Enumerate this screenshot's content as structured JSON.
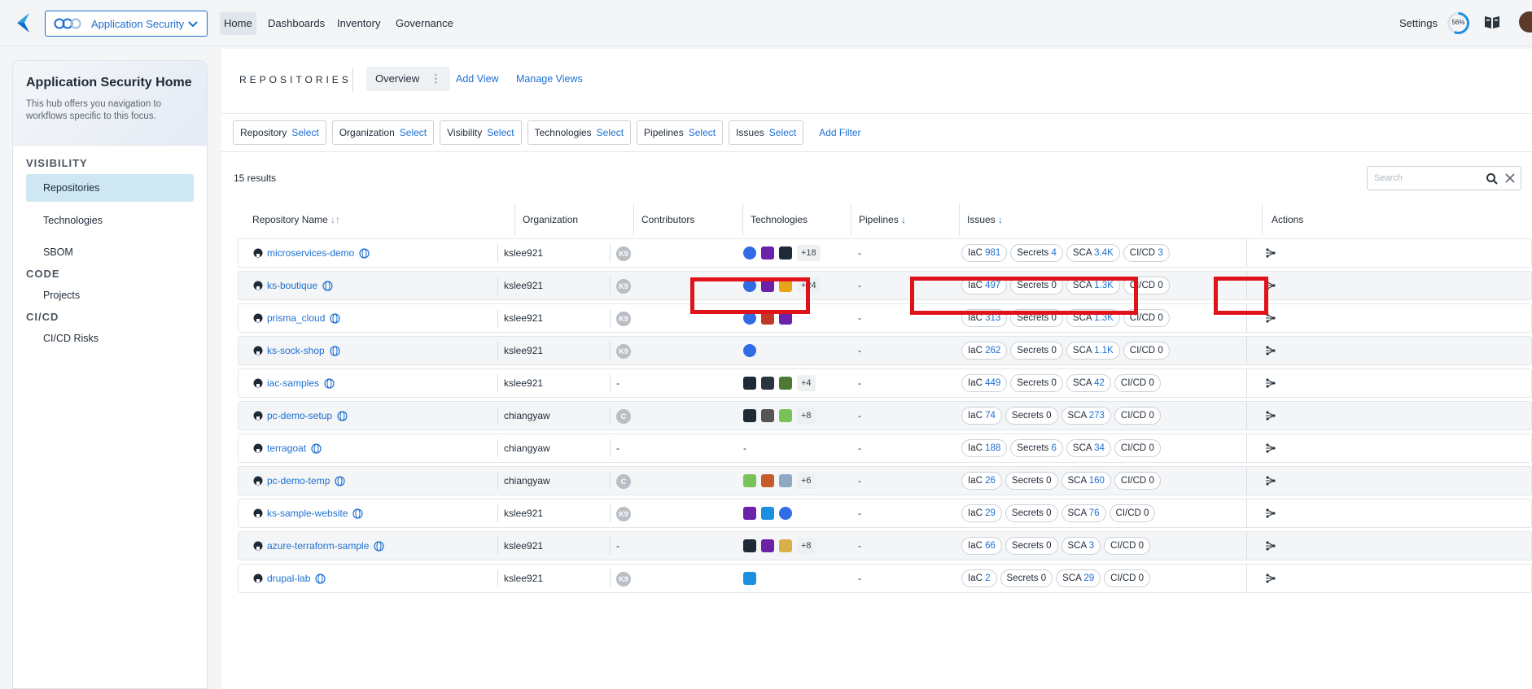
{
  "nav": {
    "app_label": "Application Security",
    "items": [
      "Home",
      "Dashboards",
      "Inventory",
      "Governance"
    ],
    "settings": "Settings",
    "progress": "56%"
  },
  "sidebar": {
    "title": "Application Security Home",
    "description": "This hub offers you navigation to workflows specific to this focus.",
    "sections": [
      {
        "label": "VISIBILITY",
        "items": [
          "Repositories",
          "Technologies",
          "SBOM"
        ]
      },
      {
        "label": "CODE",
        "items": [
          "Projects"
        ]
      },
      {
        "label": "CI/CD",
        "items": [
          "CI/CD Risks"
        ]
      }
    ]
  },
  "main": {
    "section_label": "REPOSITORIES",
    "tab_overview": "Overview",
    "add_view": "Add View",
    "manage_views": "Manage Views",
    "filters": [
      {
        "label": "Repository",
        "select": "Select"
      },
      {
        "label": "Organization",
        "select": "Select"
      },
      {
        "label": "Visibility",
        "select": "Select"
      },
      {
        "label": "Technologies",
        "select": "Select"
      },
      {
        "label": "Pipelines",
        "select": "Select"
      },
      {
        "label": "Issues",
        "select": "Select"
      }
    ],
    "add_filter": "Add Filter",
    "results": "15 results",
    "search_placeholder": "Search"
  },
  "table": {
    "columns": [
      "Repository Name",
      "Organization",
      "Contributors",
      "Technologies",
      "Pipelines",
      "Issues",
      "Actions"
    ],
    "rows": [
      {
        "name": "microservices-demo",
        "org": "kslee921",
        "contrib": "K9",
        "tech": [
          "kube",
          "shield",
          "hashi"
        ],
        "more": "+18",
        "pipelines": "-",
        "iac": "981",
        "secrets": "4",
        "sca": "3.4K",
        "cicd": "3"
      },
      {
        "name": "ks-boutique",
        "org": "kslee921",
        "contrib": "K9",
        "tech": [
          "kube",
          "shield",
          "swift"
        ],
        "more": "+24",
        "pipelines": "-",
        "iac": "497",
        "secrets": "0",
        "sca": "1.3K",
        "cicd": "0"
      },
      {
        "name": "prisma_cloud",
        "org": "kslee921",
        "contrib": "K9",
        "tech": [
          "kube",
          "jenkins",
          "shield"
        ],
        "more": "",
        "pipelines": "-",
        "iac": "313",
        "secrets": "0",
        "sca": "1.3K",
        "cicd": "0"
      },
      {
        "name": "ks-sock-shop",
        "org": "kslee921",
        "contrib": "K9",
        "tech": [
          "kube"
        ],
        "more": "",
        "pipelines": "-",
        "iac": "262",
        "secrets": "0",
        "sca": "1.1K",
        "cicd": "0"
      },
      {
        "name": "iac-samples",
        "org": "kslee921",
        "contrib": "-",
        "tech": [
          "hashi",
          "ring",
          "node"
        ],
        "more": "+4",
        "pipelines": "-",
        "iac": "449",
        "secrets": "0",
        "sca": "42",
        "cicd": "0"
      },
      {
        "name": "pc-demo-setup",
        "org": "chiangyaw",
        "contrib": "C",
        "tech": [
          "hashi",
          "cube",
          "android"
        ],
        "more": "+8",
        "pipelines": "-",
        "iac": "74",
        "secrets": "0",
        "sca": "273",
        "cicd": "0"
      },
      {
        "name": "terragoat",
        "org": "chiangyaw",
        "contrib": "-",
        "tech": [],
        "more": "",
        "tech_dash": "-",
        "pipelines": "-",
        "iac": "188",
        "secrets": "6",
        "sca": "34",
        "cicd": "0"
      },
      {
        "name": "pc-demo-temp",
        "org": "chiangyaw",
        "contrib": "C",
        "tech": [
          "android",
          "maven",
          "mysql"
        ],
        "more": "+6",
        "pipelines": "-",
        "iac": "26",
        "secrets": "0",
        "sca": "160",
        "cicd": "0"
      },
      {
        "name": "ks-sample-website",
        "org": "kslee921",
        "contrib": "K9",
        "tech": [
          "shield",
          "docker",
          "kube"
        ],
        "more": "",
        "pipelines": "-",
        "iac": "29",
        "secrets": "0",
        "sca": "76",
        "cicd": "0"
      },
      {
        "name": "azure-terraform-sample",
        "org": "kslee921",
        "contrib": "-",
        "tech": [
          "hashi",
          "shield",
          "yaml"
        ],
        "more": "+8",
        "pipelines": "-",
        "iac": "66",
        "secrets": "0",
        "sca": "3",
        "cicd": "0"
      },
      {
        "name": "drupal-lab",
        "org": "kslee921",
        "contrib": "K9",
        "tech": [
          "docker"
        ],
        "more": "",
        "pipelines": "-",
        "iac": "2",
        "secrets": "0",
        "sca": "29",
        "cicd": "0"
      }
    ],
    "pill_labels": {
      "iac": "IaC",
      "secrets": "Secrets",
      "sca": "SCA",
      "cicd": "CI/CD"
    }
  },
  "colors": {
    "accent": "#1d6fd1",
    "highlight": "#e0121b",
    "active_nav": "#cfe6f3"
  }
}
